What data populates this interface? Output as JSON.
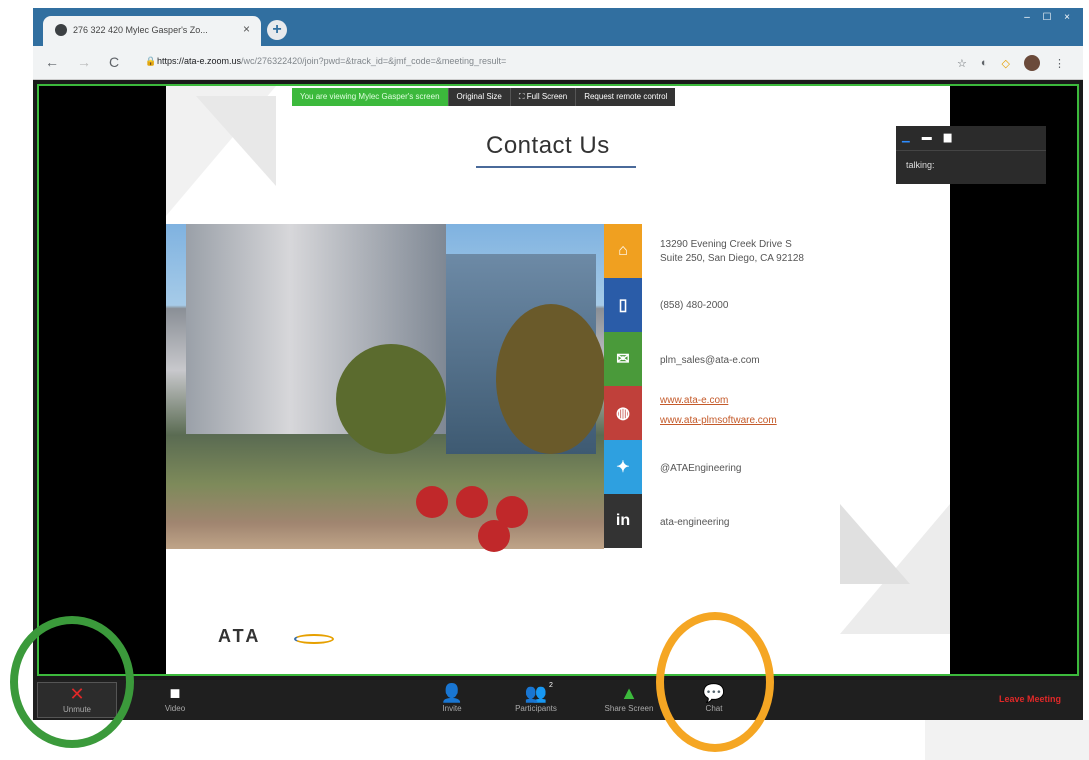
{
  "browser": {
    "tab_title": "276 322 420 Mylec Gasper's Zo...",
    "tab_close": "×",
    "new_tab": "+",
    "url_host": "https://ata-e.zoom.us",
    "url_path": "/wc/276322420/join?pwd=&track_id=&jmf_code=&meeting_result=",
    "window_buttons": [
      "–",
      "☐",
      "×"
    ]
  },
  "share_bar": {
    "viewing_text": "You are viewing Mylec Gasper's screen",
    "original_size": "Original Size",
    "full_screen": "⛶ Full Screen",
    "request_control": "Request remote control"
  },
  "slide": {
    "title": "Contact Us",
    "address_line1": "13290 Evening Creek Drive S",
    "address_line2": "Suite 250, San Diego, CA 92128",
    "phone": "(858) 480-2000",
    "email": "plm_sales@ata-e.com",
    "web1": "www.ata-e.com",
    "web2": "www.ata-plmsoftware.com",
    "twitter": "@ATAEngineering",
    "linkedin": "ata-engineering",
    "logo": "ATA",
    "linkedin_glyph": "in",
    "colors": {
      "orange": "#f0a020",
      "blue": "#2a5ca8",
      "green": "#4a9a3a",
      "red": "#c0403a",
      "twitter": "#2ea0e0",
      "linkedin": "#333333"
    }
  },
  "talking_panel": {
    "label": "talking:"
  },
  "meeting_bar": {
    "unmute": "Unmute",
    "video": "Video",
    "invite": "Invite",
    "participants": "Participants",
    "participants_count": "2",
    "share_screen": "Share Screen",
    "chat": "Chat",
    "leave": "Leave Meeting"
  }
}
